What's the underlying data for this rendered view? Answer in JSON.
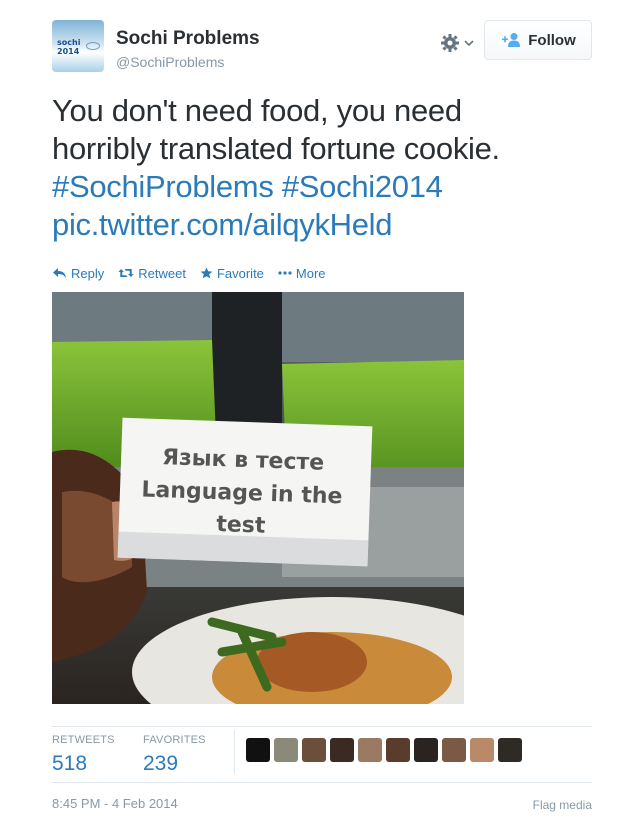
{
  "user": {
    "name": "Sochi Problems",
    "handle": "@SochiProblems",
    "avatar_lines": [
      "sochi",
      "2014"
    ]
  },
  "follow_button": {
    "label": "Follow",
    "icon": "add-user-icon"
  },
  "settings": {
    "icon": "gear-icon"
  },
  "tweet": {
    "line1": "You don't need food, you need",
    "line2": "horribly translated fortune cookie.",
    "hashtag1": "#SochiProblems",
    "hashtag2": "#Sochi2014",
    "link": "pic.twitter.com/ailqykHeld"
  },
  "actions": [
    {
      "label": "Reply",
      "icon": "reply-icon"
    },
    {
      "label": "Retweet",
      "icon": "retweet-icon"
    },
    {
      "label": "Favorite",
      "icon": "star-icon"
    },
    {
      "label": "More",
      "icon": "more-dots-icon"
    }
  ],
  "photo": {
    "sign_line1": "Язык в тесте",
    "sign_line2": "Language in the",
    "sign_line3": "test"
  },
  "stats": {
    "retweets_label": "RETWEETS",
    "retweets_count": "518",
    "favorites_label": "FAVORITES",
    "favorites_count": "239"
  },
  "favoriter_colors": [
    "#111111",
    "#8b8a7a",
    "#6b4f3a",
    "#3a2a22",
    "#9a7a62",
    "#5a3c2c",
    "#2a2320",
    "#7a5a44",
    "#b88a6a",
    "#2e2a26"
  ],
  "footer": {
    "timestamp": "8:45 PM - 4 Feb 2014",
    "flag_label": "Flag media"
  },
  "colors": {
    "link": "#2b7bb9",
    "text": "#292f33",
    "muted": "#8899a6"
  }
}
